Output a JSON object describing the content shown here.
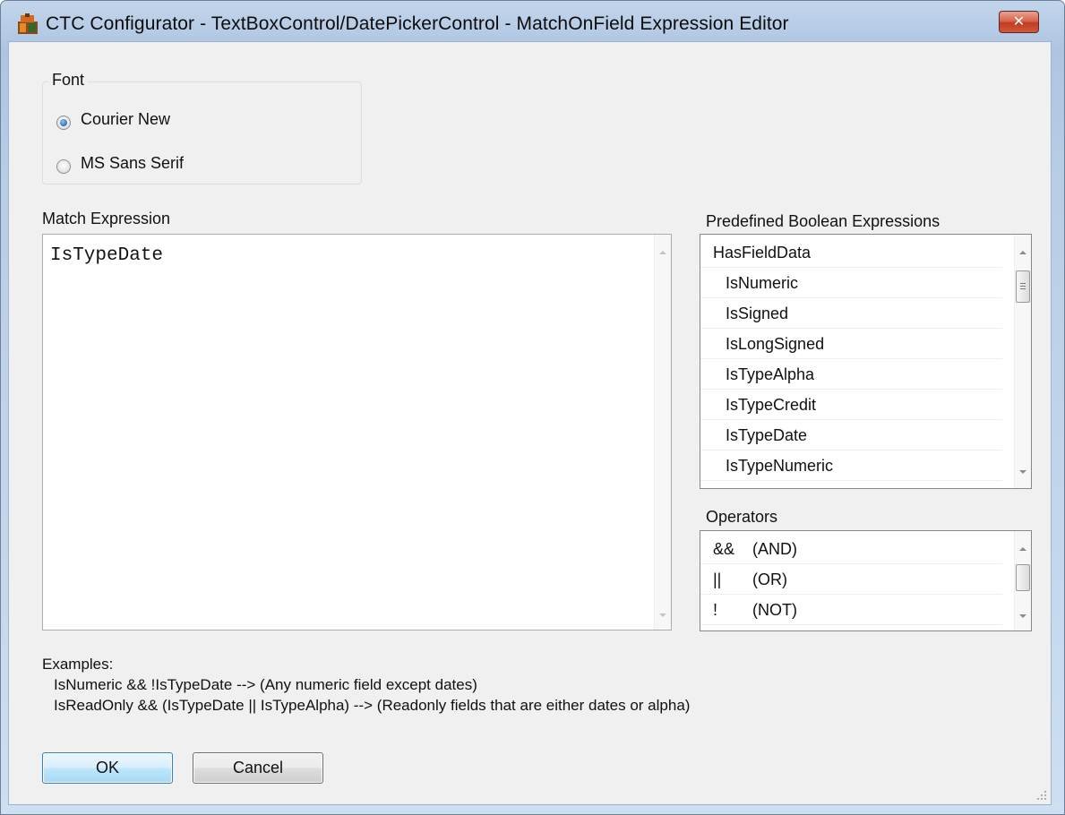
{
  "window": {
    "title": "CTC Configurator - TextBoxControl/DatePickerControl - MatchOnField Expression Editor",
    "close_glyph": "✕",
    "icon": "ctc-app-icon",
    "close_icon": "close-icon"
  },
  "font_group": {
    "label": "Font",
    "options": [
      {
        "label": "Courier New",
        "checked": true
      },
      {
        "label": "MS Sans Serif",
        "checked": false
      }
    ]
  },
  "match_expression": {
    "label": "Match Expression",
    "value": "IsTypeDate"
  },
  "predefined": {
    "label": "Predefined Boolean Expressions",
    "items": [
      "HasFieldData",
      "IsNumeric",
      "IsSigned",
      "IsLongSigned",
      "IsTypeAlpha",
      "IsTypeCredit",
      "IsTypeDate",
      "IsTypeNumeric"
    ]
  },
  "operators": {
    "label": "Operators",
    "items": [
      {
        "symbol": "&&",
        "name": "(AND)"
      },
      {
        "symbol": "||",
        "name": "(OR)"
      },
      {
        "symbol": "!",
        "name": "(NOT)"
      }
    ]
  },
  "examples": {
    "heading": "Examples:",
    "lines": [
      "IsNumeric && !IsTypeDate --> (Any numeric field except dates)",
      "IsReadOnly && (IsTypeDate || IsTypeAlpha) --> (Readonly fields that are either dates or alpha)"
    ]
  },
  "buttons": {
    "ok": "OK",
    "cancel": "Cancel"
  },
  "colors": {
    "title_bar": "#b8cde6",
    "client_bg": "#f0f0f0",
    "close_button": "#c13b22",
    "radio_checked": "#2a6fc4",
    "ok_button_border": "#3c7fb1"
  }
}
